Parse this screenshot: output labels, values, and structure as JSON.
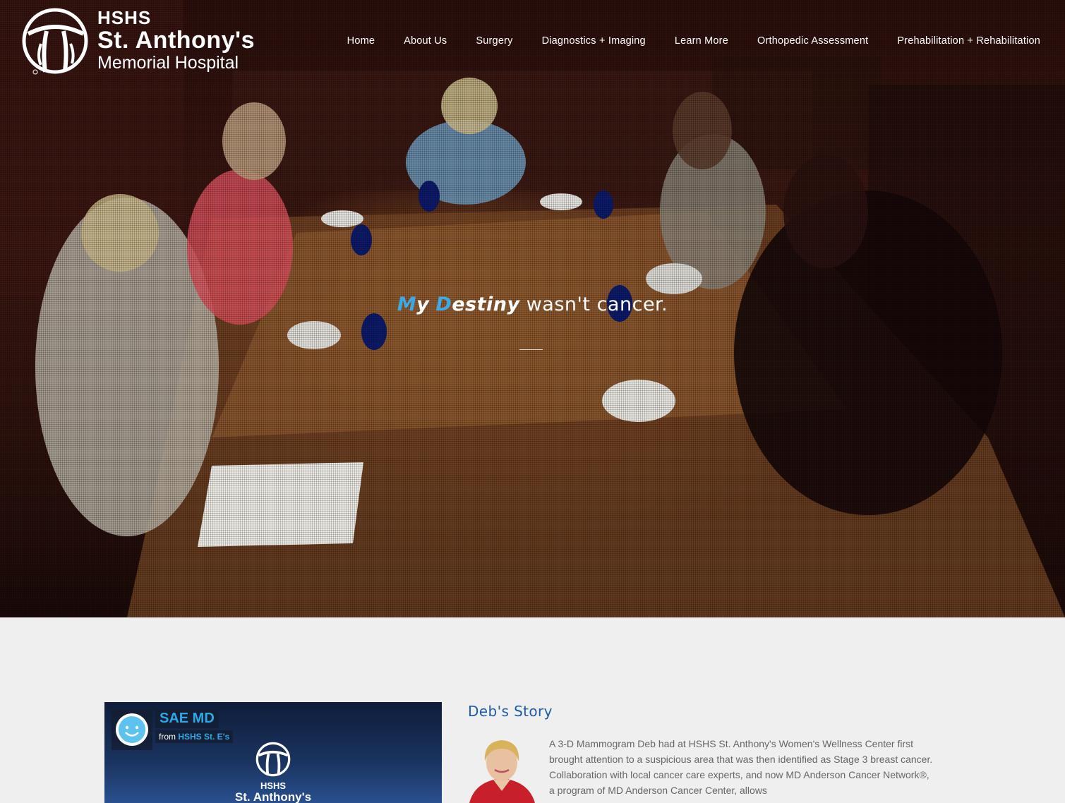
{
  "header": {
    "logo": {
      "line1": "HSHS",
      "line2": "St. Anthony's",
      "line3": "Memorial Hospital"
    },
    "nav": [
      {
        "label": "Home"
      },
      {
        "label": "About Us"
      },
      {
        "label": "Surgery"
      },
      {
        "label": "Diagnostics + Imaging"
      },
      {
        "label": "Learn More"
      },
      {
        "label": "Orthopedic Assessment"
      },
      {
        "label": "Prehabilitation + Rehabilitation"
      }
    ]
  },
  "hero": {
    "tagline": {
      "m": "M",
      "y": "y",
      "d": "D",
      "estiny": "estiny",
      "rest": " wasn't cancer."
    }
  },
  "video": {
    "channel": "SAE MD",
    "from_label": "from",
    "from_source": "HSHS St. E's",
    "logo_line1": "HSHS",
    "logo_line2": "St. Anthony's"
  },
  "story": {
    "title": "Deb's Story",
    "text": "A 3-D Mammogram Deb had at HSHS St. Anthony's Women's Wellness Center first brought attention to a suspicious area that was then identified as Stage 3 breast cancer. Collaboration with local cancer care experts, and now MD Anderson Cancer Network®, a program of MD Anderson Cancer Center, allows"
  },
  "colors": {
    "accent_blue": "#3fa9e6",
    "title_blue": "#1d5ba8",
    "page_bg": "#efefef"
  }
}
